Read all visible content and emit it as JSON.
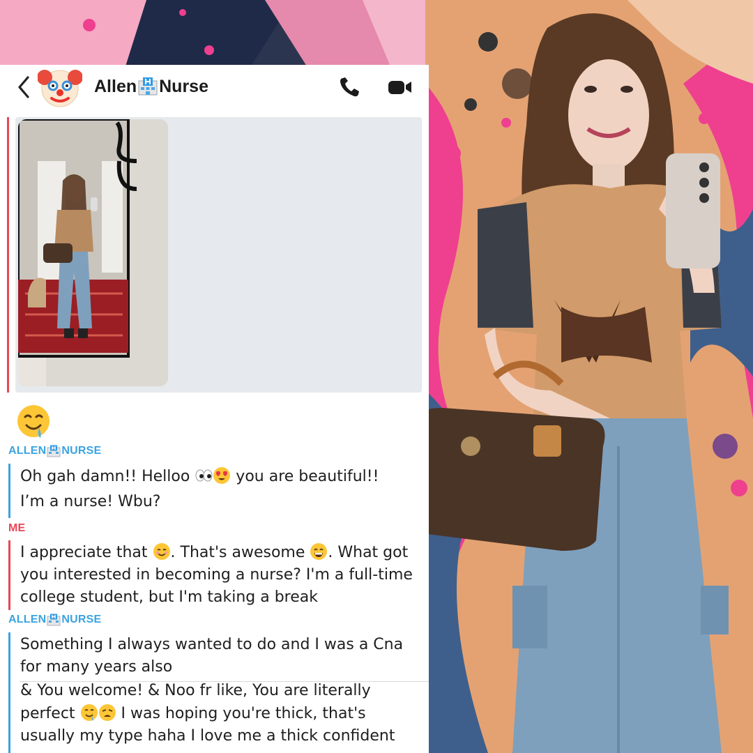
{
  "chat": {
    "contact_name_part1": "Allen",
    "contact_name_part2": "Nurse",
    "contact_emoji_avatar": "clown-face",
    "name_separator_icon": "hospital-icon",
    "sender_allen_part1": "ALLEN",
    "sender_allen_part2": "NURSE",
    "sender_me": "ME",
    "reaction_emoji": "drooling-face",
    "messages": {
      "allen_1_line1_a": "Oh gah damn!! Helloo ",
      "allen_1_line1_b": " you are beautiful!!",
      "allen_2": "I’m a nurse! Wbu?",
      "me_1_line1_a": "I appreciate that ",
      "me_1_line1_b": ". That's awesome ",
      "me_1_line1_c": ". What got",
      "me_1_line2": "you interested in becoming a nurse? I'm a full-time",
      "me_1_line3": "college student, but I'm taking a break",
      "allen_3_line1": "Something I always wanted to do and I was a Cna",
      "allen_3_line2": "for many years also",
      "allen_4_line1": "& You welcome! & Noo fr like, You are literally",
      "allen_4_line2_a": "perfect ",
      "allen_4_line2_b": " I was hoping you're thick, that's",
      "allen_4_line3": "usually my type haha I love me a thick confident"
    }
  },
  "colors": {
    "allen_accent": "#3aa3e0",
    "me_accent": "#e94556",
    "backdrop_pink": "#ef3f8f",
    "backdrop_orange": "#e6a878",
    "backdrop_navy": "#2c3550"
  }
}
